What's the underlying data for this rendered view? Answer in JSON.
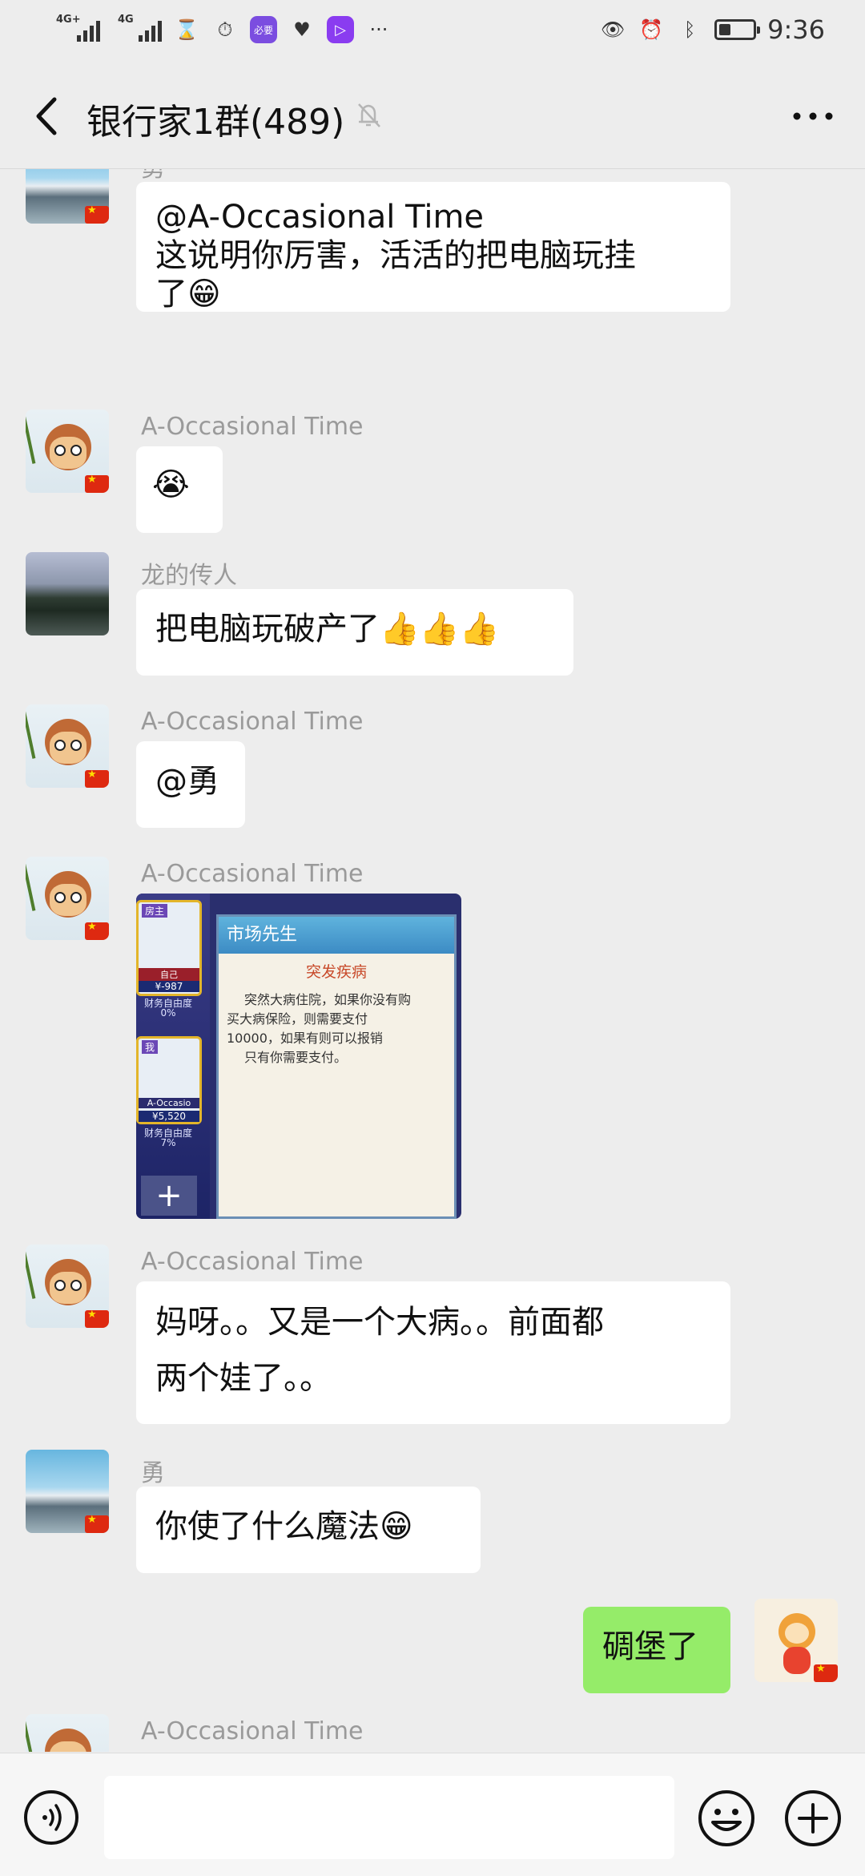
{
  "status_bar": {
    "signal1_label": "4G+",
    "signal2_label": "4G",
    "app_badge1": "必要",
    "more_indicator": "···",
    "battery_level": 0.35,
    "time": "9:36"
  },
  "header": {
    "title": "银行家1群(489)"
  },
  "messages": [
    {
      "sender": "勇",
      "text_line1": "@A-Occasional Time",
      "text_line2": "这说明你厉害，活活的把电脑玩挂",
      "text_line3": "了",
      "emoji": "😁"
    },
    {
      "sender": "A-Occasional Time",
      "emoji": "😭"
    },
    {
      "sender": "龙的传人",
      "text": "把电脑玩破产了",
      "emoji": "👍👍👍"
    },
    {
      "sender": "A-Occasional Time",
      "text": "@勇"
    },
    {
      "sender": "A-Occasional Time",
      "image": {
        "card1_tag": "房主",
        "card1_name": "自己",
        "card1_money": "¥-987",
        "card1_stat": "财务自由度",
        "card1_pct": "0%",
        "card2_tag": "我",
        "card2_name": "A-Occasio",
        "card2_money": "¥5,520",
        "card2_stat": "财务自由度",
        "card2_pct": "7%",
        "panel_title": "市场先生",
        "panel_subtitle": "突发疾病",
        "panel_body1": "突然大病住院，如果你没有购",
        "panel_body2": "买大病保险，则需要支付",
        "panel_body3": "10000，如果有则可以报销",
        "panel_body4": "只有你需要支付。",
        "plus_sign": "+"
      }
    },
    {
      "sender": "A-Occasional Time",
      "text_line1": "妈呀。。又是一个大病。。前面都",
      "text_line2": "两个娃了。。"
    },
    {
      "sender": "勇",
      "text": "你使了什么魔法",
      "emoji": "😁"
    },
    {
      "sender": "me",
      "text": "碉堡了"
    },
    {
      "sender": "A-Occasional Time"
    }
  ],
  "colors": {
    "background": "#ededed",
    "bubble_other": "#ffffff",
    "bubble_me": "#95ec69",
    "sender_name": "#9a9a9a"
  },
  "icons": [
    "back-arrow-icon",
    "mute-bell-icon",
    "more-icon",
    "voice-icon",
    "emoji-icon",
    "plus-icon"
  ]
}
